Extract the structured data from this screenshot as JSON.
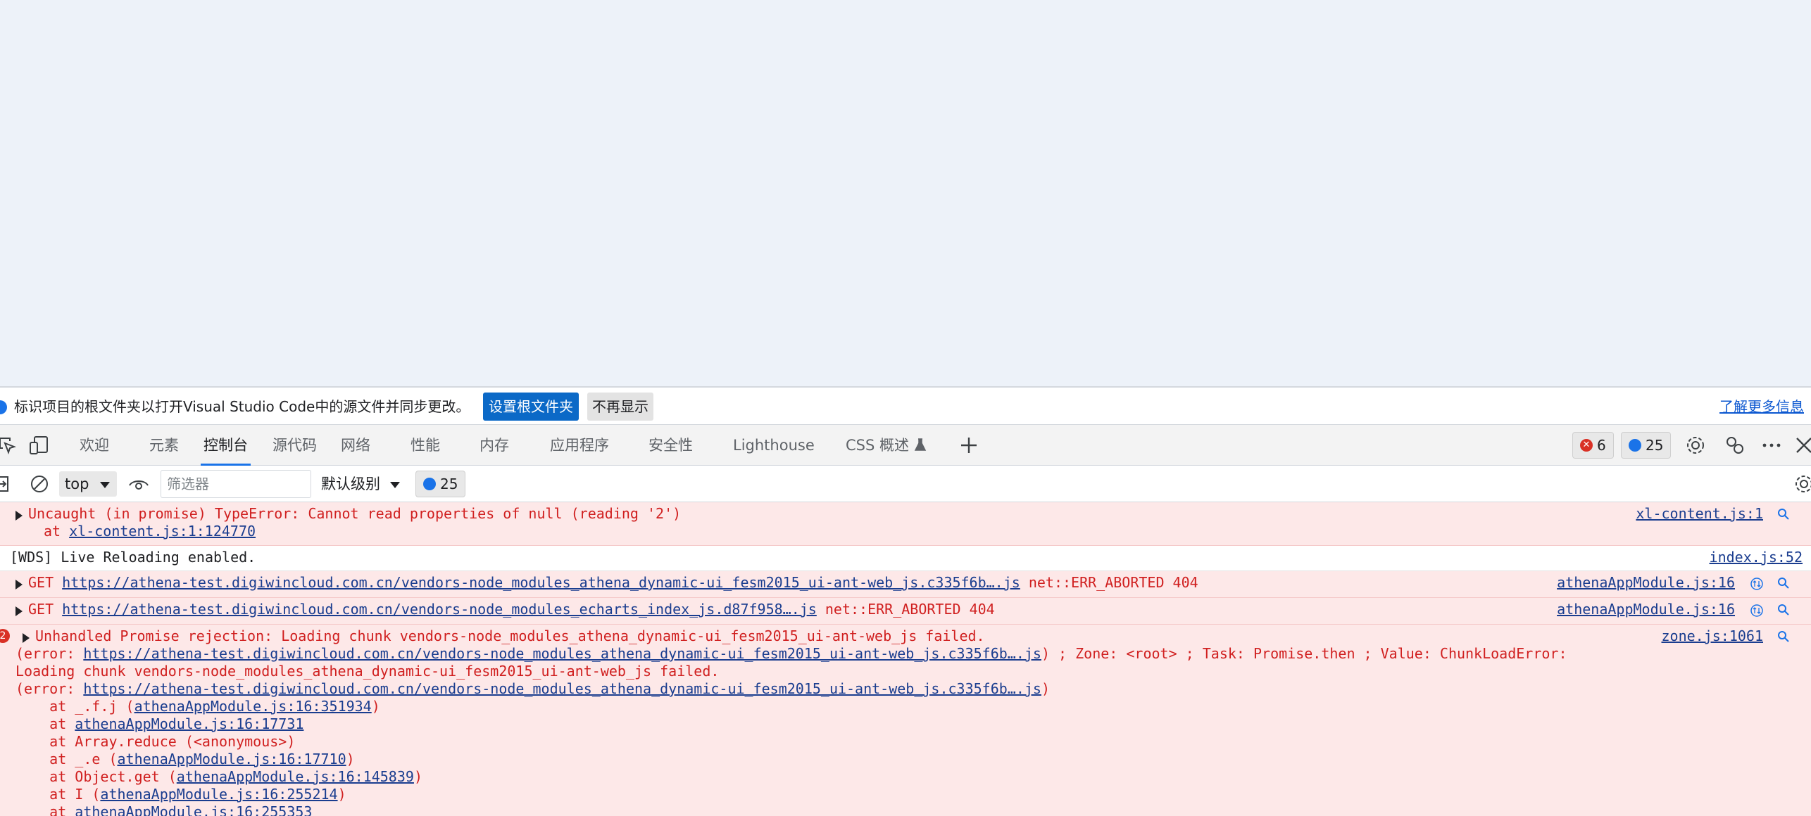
{
  "infobar": {
    "message": "标识项目的根文件夹以打开Visual Studio Code中的源文件并同步更改。",
    "primary_button": "设置根文件夹",
    "secondary_button": "不再显示",
    "learn_more": "了解更多信息"
  },
  "tabs": [
    {
      "label": "欢迎",
      "active": false
    },
    {
      "label": "元素",
      "active": false
    },
    {
      "label": "控制台",
      "active": true
    },
    {
      "label": "源代码",
      "active": false
    },
    {
      "label": "网络",
      "active": false
    },
    {
      "label": "性能",
      "active": false
    },
    {
      "label": "内存",
      "active": false
    },
    {
      "label": "应用程序",
      "active": false
    },
    {
      "label": "安全性",
      "active": false
    },
    {
      "label": "Lighthouse",
      "active": false
    },
    {
      "label": "CSS 概述",
      "active": false
    }
  ],
  "tab_counts": {
    "errors": "6",
    "messages": "25"
  },
  "toolbar": {
    "context": "top",
    "filter_placeholder": "筛选器",
    "level": "默认级别",
    "message_count": "25"
  },
  "console": {
    "r1": {
      "text": "Uncaught (in promise) TypeError: Cannot read properties of null (reading '2')",
      "at_prefix": "at ",
      "at_link": "xl-content.js:1:124770",
      "source": "xl-content.js:1"
    },
    "r2": {
      "text": "[WDS] Live Reloading enabled.",
      "source": "index.js:52"
    },
    "r3": {
      "method": "GET ",
      "url": "https://athena-test.digiwincloud.com.cn/vendors-node_modules_athena_dynamic-ui_fesm2015_ui-ant-web_js.c335f6b….js",
      "status": " net::ERR_ABORTED 404",
      "source": "athenaAppModule.js:16"
    },
    "r4": {
      "method": "GET ",
      "url": "https://athena-test.digiwincloud.com.cn/vendors-node_modules_echarts_index_js.d87f958….js",
      "status": " net::ERR_ABORTED 404",
      "source": "athenaAppModule.js:16"
    },
    "r5": {
      "count": "2",
      "text": "Unhandled Promise rejection: Loading chunk vendors-node_modules_athena_dynamic-ui_fesm2015_ui-ant-web_js failed.",
      "l2_prefix": "(error: ",
      "l2_link": "https://athena-test.digiwincloud.com.cn/vendors-node_modules_athena_dynamic-ui_fesm2015_ui-ant-web_js.c335f6b….js",
      "l2_suffix": ") ; Zone: <root> ; Task: Promise.then ; Value: ChunkLoadError:",
      "l3": "Loading chunk vendors-node_modules_athena_dynamic-ui_fesm2015_ui-ant-web_js failed.",
      "l4_prefix": "(error: ",
      "l4_link": "https://athena-test.digiwincloud.com.cn/vendors-node_modules_athena_dynamic-ui_fesm2015_ui-ant-web_js.c335f6b….js",
      "l4_suffix": ")",
      "source": "zone.js:1061",
      "stack": [
        {
          "prefix": "    at _.f.j (",
          "link": "athenaAppModule.js:16:351934",
          "suffix": ")"
        },
        {
          "prefix": "    at ",
          "link": "athenaAppModule.js:16:17731",
          "suffix": ""
        },
        {
          "prefix": "    at Array.reduce (<anonymous>)",
          "link": "",
          "suffix": ""
        },
        {
          "prefix": "    at _.e (",
          "link": "athenaAppModule.js:16:17710",
          "suffix": ")"
        },
        {
          "prefix": "    at Object.get (",
          "link": "athenaAppModule.js:16:145839",
          "suffix": ")"
        },
        {
          "prefix": "    at I (",
          "link": "athenaAppModule.js:16:255214",
          "suffix": ")"
        },
        {
          "prefix": "    at ",
          "link": "athenaAppModule.js:16:255353",
          "suffix": ""
        }
      ]
    }
  }
}
